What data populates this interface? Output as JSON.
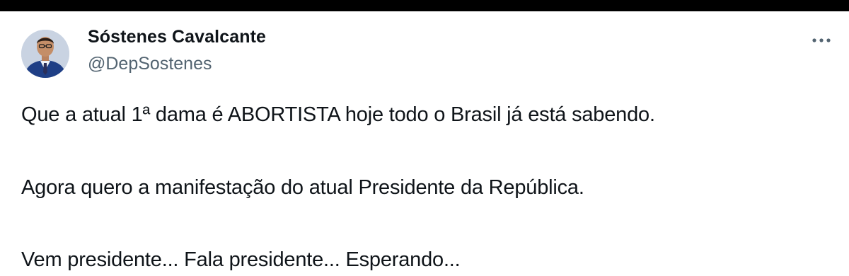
{
  "tweet": {
    "author": {
      "name": "Sóstenes Cavalcante",
      "handle": "@DepSostenes",
      "avatar_icon": "profile-photo-avatar"
    },
    "menu_icon": "more-horizontal-icon",
    "text_lines": [
      "Que a atual 1ª dama é ABORTISTA hoje todo o Brasil já está sabendo.",
      "Agora quero a manifestação do atual Presidente da República.",
      "Vem presidente... Fala presidente... Esperando..."
    ]
  },
  "colors": {
    "text_primary": "#0f1419",
    "text_secondary": "#536471",
    "background": "#ffffff",
    "top_bar": "#000000"
  }
}
